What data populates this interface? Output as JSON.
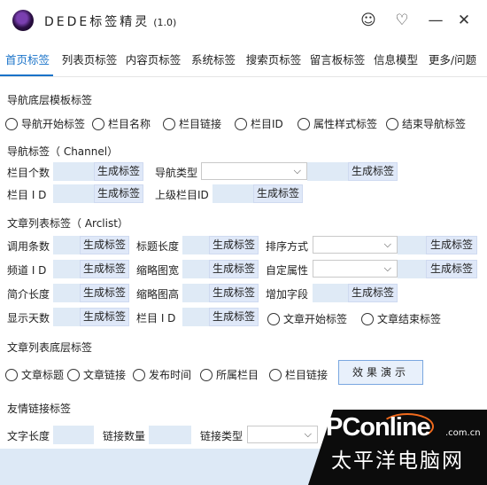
{
  "app": {
    "title": "DEDE标签精灵",
    "version": "(1.0)"
  },
  "window": {
    "smile_icon": "smile-icon",
    "heart_icon": "heart-icon",
    "minimize": "—",
    "close": "✕"
  },
  "tabs": [
    "首页标签",
    "列表页标签",
    "内容页标签",
    "系统标签",
    "搜索页标签",
    "留言板标签",
    "信息模型",
    "更多/问题"
  ],
  "sections": {
    "nav_footer": {
      "title": "导航底层模板标签",
      "radios": [
        "导航开始标签",
        "栏目名称",
        "栏目链接",
        "栏目ID",
        "属性样式标签",
        "结束导航标签"
      ]
    },
    "nav": {
      "title": "导航标签（ Channel）",
      "row1": {
        "count_label": "栏目个数",
        "type_label": "导航类型"
      },
      "row2": {
        "id_label": "栏目 I D",
        "parent_label": "上级栏目ID"
      }
    },
    "arclist": {
      "title": "文章列表标签（ Arclist）",
      "row1": {
        "a": "调用条数",
        "b": "标题长度",
        "c": "排序方式"
      },
      "row2": {
        "a": "频道 I D",
        "b": "缩略图宽",
        "c": "自定属性"
      },
      "row3": {
        "a": "简介长度",
        "b": "缩略图高",
        "c": "增加字段"
      },
      "row4": {
        "a": "显示天数",
        "b": "栏目 I D",
        "r1": "文章开始标签",
        "r2": "文章结束标签"
      }
    },
    "arc_footer": {
      "title": "文章列表底层标签",
      "radios": [
        "文章标题",
        "文章链接",
        "发布时间",
        "所属栏目",
        "栏目链接"
      ],
      "demo_button": "效果演示"
    },
    "flink": {
      "title": "友情链接标签",
      "labels": [
        "文字长度",
        "链接数量",
        "链接类型"
      ]
    }
  },
  "gen_label": "生成标签",
  "watermark": {
    "main": "PConline",
    "domain": ".com.cn",
    "cn": "太平洋电脑网"
  },
  "colors": {
    "accent": "#1a73c9",
    "field_bg": "#dfeaf6",
    "button_bg": "#dfe8f8"
  }
}
